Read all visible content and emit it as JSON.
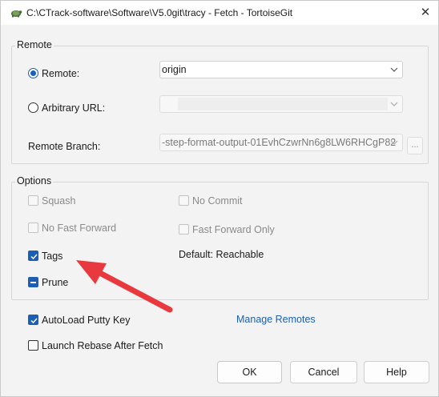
{
  "window": {
    "title": "C:\\CTrack-software\\Software\\V5.0git\\tracy - Fetch - TortoiseGit",
    "icon": "tortoisegit-icon",
    "close_icon": "close-icon"
  },
  "remote_group": {
    "title": "Remote",
    "remote_radio": {
      "label": "Remote:",
      "selected": true
    },
    "remote_combo": {
      "value": "origin"
    },
    "arbitrary_radio": {
      "label": "Arbitrary URL:",
      "selected": false
    },
    "arbitrary_combo": {
      "value": "",
      "enabled": false
    },
    "branch_label": "Remote Branch:",
    "branch_combo": {
      "value": "-step-format-output-01EvhCzwrNn6g8LW6RHCgP82",
      "enabled": false
    },
    "browse_button": "..."
  },
  "options_group": {
    "title": "Options",
    "squash": {
      "label": "Squash",
      "checked": false,
      "enabled": false
    },
    "no_commit": {
      "label": "No Commit",
      "checked": false,
      "enabled": false
    },
    "no_fast_forward": {
      "label": "No Fast Forward",
      "checked": false,
      "enabled": false
    },
    "fast_forward_only": {
      "label": "Fast Forward Only",
      "checked": false,
      "enabled": false
    },
    "tags": {
      "label": "Tags",
      "checked": true
    },
    "default_reachable": "Default: Reachable",
    "prune": {
      "label": "Prune",
      "state": "indeterminate"
    }
  },
  "autoload_putty": {
    "label": "AutoLoad Putty Key",
    "checked": true
  },
  "manage_remotes": "Manage Remotes",
  "launch_rebase": {
    "label": "Launch Rebase After Fetch",
    "checked": false
  },
  "buttons": {
    "ok": "OK",
    "cancel": "Cancel",
    "help": "Help"
  },
  "annotation": {
    "arrow_color": "#e8393f",
    "points_to": "Tags"
  },
  "colors": {
    "accent": "#1a5fb4",
    "link": "#1a5fb4",
    "arrow": "#e8393f"
  }
}
